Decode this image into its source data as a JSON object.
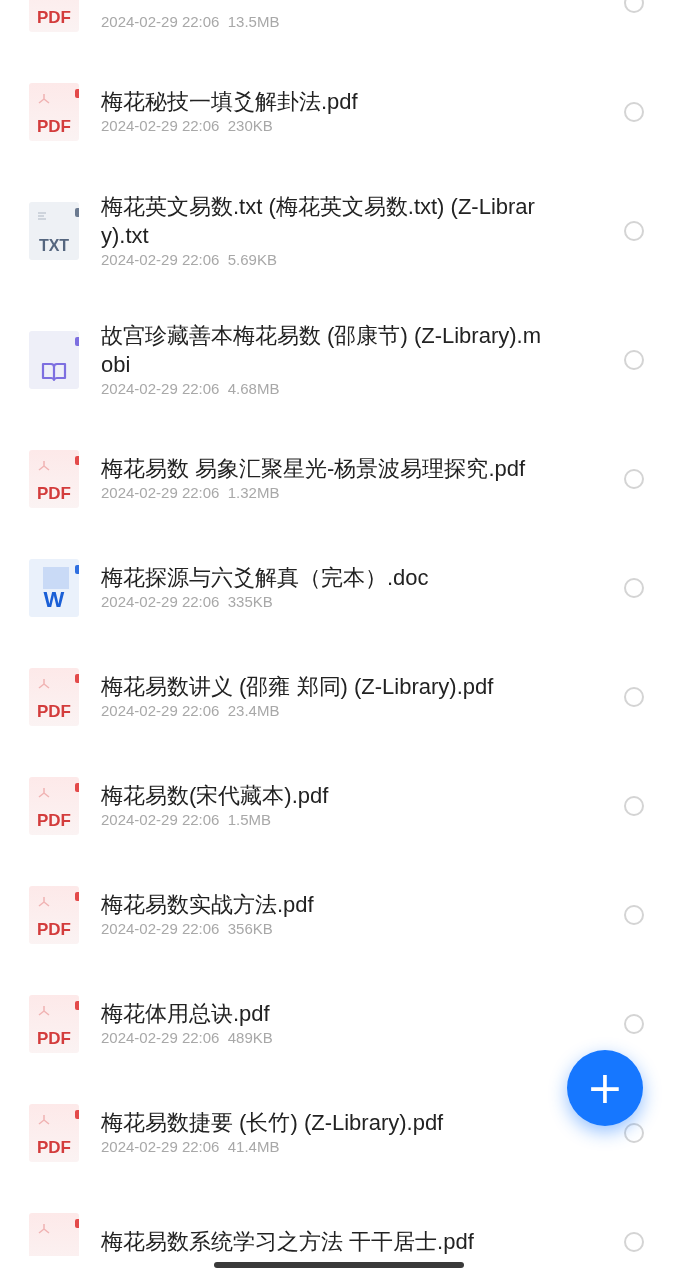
{
  "files": [
    {
      "kind": "pdf",
      "icon_label": "PDF",
      "meta": "2024-02-29 22:06  13.5MB",
      "selected": false
    },
    {
      "kind": "pdf",
      "icon_label": "PDF",
      "name": "梅花秘技一填爻解卦法.pdf",
      "meta": "2024-02-29 22:06  230KB",
      "selected": false
    },
    {
      "kind": "txt",
      "icon_label": "TXT",
      "name": "梅花英文易数.txt (梅花英文易数.txt) (Z-Library).txt",
      "meta": "2024-02-29 22:06  5.69KB",
      "selected": false
    },
    {
      "kind": "mobi",
      "name": "故宫珍藏善本梅花易数 (邵康节) (Z-Library).mobi",
      "meta": "2024-02-29 22:06  4.68MB",
      "selected": false
    },
    {
      "kind": "pdf",
      "icon_label": "PDF",
      "name": "梅花易数 易象汇聚星光-杨景波易理探究.pdf",
      "meta": "2024-02-29 22:06  1.32MB",
      "selected": false
    },
    {
      "kind": "doc",
      "icon_label": "W",
      "name": "梅花探源与六爻解真（完本）.doc",
      "meta": "2024-02-29 22:06  335KB",
      "selected": false
    },
    {
      "kind": "pdf",
      "icon_label": "PDF",
      "name": "梅花易数讲义 (邵雍 郑同) (Z-Library).pdf",
      "meta": "2024-02-29 22:06  23.4MB",
      "selected": false
    },
    {
      "kind": "pdf",
      "icon_label": "PDF",
      "name": "梅花易数(宋代藏本).pdf",
      "meta": "2024-02-29 22:06  1.5MB",
      "selected": false
    },
    {
      "kind": "pdf",
      "icon_label": "PDF",
      "name": "梅花易数实战方法.pdf",
      "meta": "2024-02-29 22:06  356KB",
      "selected": false
    },
    {
      "kind": "pdf",
      "icon_label": "PDF",
      "name": "梅花体用总诀.pdf",
      "meta": "2024-02-29 22:06  489KB",
      "selected": false
    },
    {
      "kind": "pdf",
      "icon_label": "PDF",
      "name": "梅花易数捷要 (长竹) (Z-Library).pdf",
      "meta": "2024-02-29 22:06  41.4MB",
      "selected": false
    },
    {
      "kind": "pdf",
      "name": "梅花易数系统学习之方法 干干居士.pdf",
      "selected": false
    }
  ],
  "fab": {
    "label": "+"
  }
}
